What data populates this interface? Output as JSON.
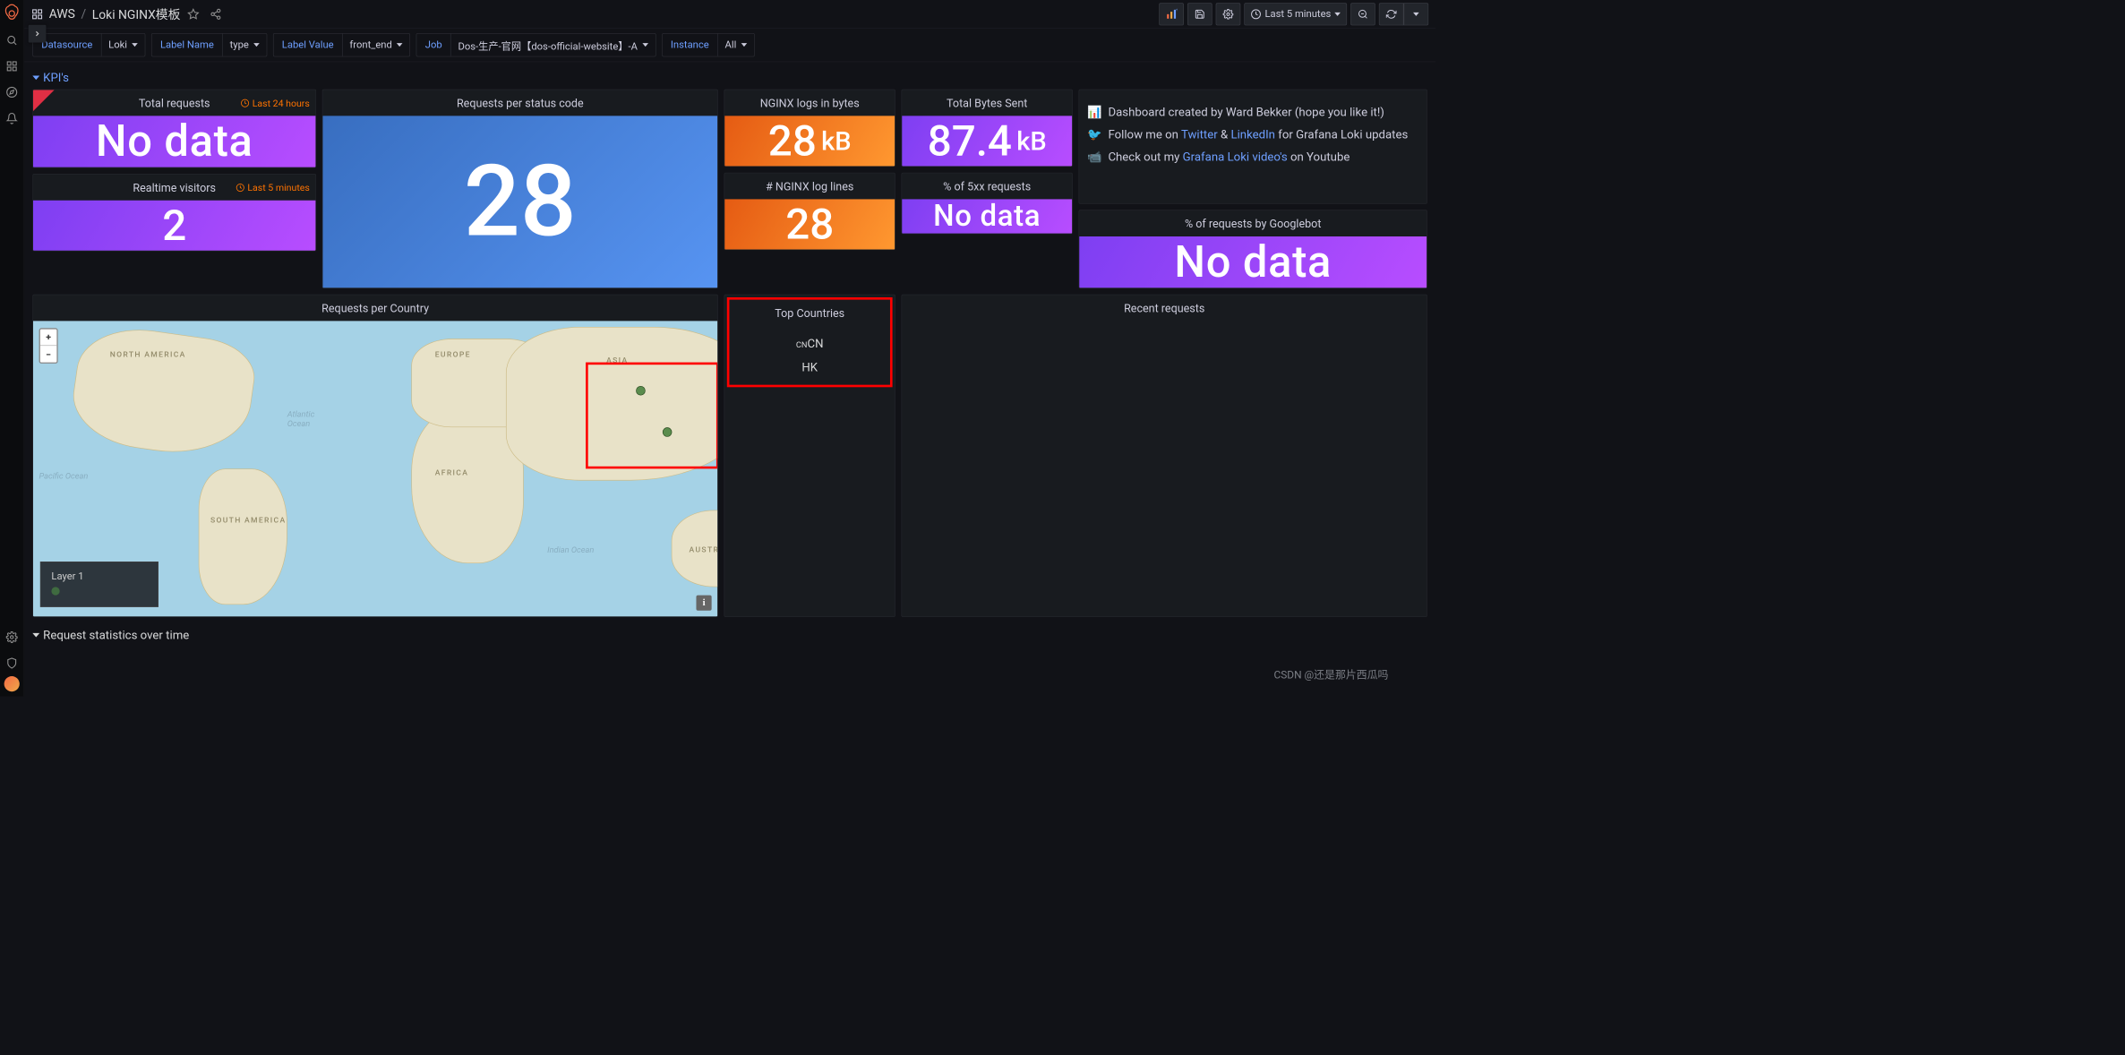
{
  "breadcrumb": {
    "root": "AWS",
    "page": "Loki NGINX模板"
  },
  "timepicker": {
    "label": "Last 5 minutes"
  },
  "variables": {
    "datasource": {
      "label": "Datasource",
      "value": "Loki"
    },
    "labelname": {
      "label": "Label Name",
      "value": "type"
    },
    "labelvalue": {
      "label": "Label Value",
      "value": "front_end"
    },
    "job": {
      "label": "Job",
      "value": "Dos-生产-官网【dos-official-website】-A"
    },
    "instance": {
      "label": "Instance",
      "value": "All"
    }
  },
  "rows": {
    "kpi": "KPI's",
    "stats": "Request statistics over time"
  },
  "panels": {
    "total_requests": {
      "title": "Total requests",
      "meta": "Last 24 hours",
      "value": "No data"
    },
    "realtime": {
      "title": "Realtime visitors",
      "meta": "Last 5 minutes",
      "value": "2"
    },
    "per_status": {
      "title": "Requests per status code",
      "value": "28"
    },
    "logs_bytes": {
      "title": "NGINX logs in bytes",
      "value": "28",
      "unit": "kB"
    },
    "total_bytes": {
      "title": "Total Bytes Sent",
      "value": "87.4",
      "unit": "kB"
    },
    "log_lines": {
      "title": "# NGINX log lines",
      "value": "28"
    },
    "pct_5xx": {
      "title": "% of 5xx requests",
      "value": "No data"
    },
    "pct_google": {
      "title": "% of requests by Googlebot",
      "value": "No data"
    },
    "per_country": {
      "title": "Requests per Country"
    },
    "top_countries": {
      "title": "Top Countries",
      "rows": [
        "CN",
        "HK"
      ],
      "row0_prefix": "CN"
    },
    "recent": {
      "title": "Recent requests"
    }
  },
  "textpanel": {
    "l1_a": "Dashboard created by Ward Bekker (hope you like it!)",
    "l2_a": "Follow me on ",
    "l2_b": "Twitter",
    "l2_c": " & ",
    "l2_d": "LinkedIn",
    "l2_e": " for Grafana Loki updates",
    "l3_a": "Check out my ",
    "l3_b": "Grafana Loki video's",
    "l3_c": " on Youtube"
  },
  "map": {
    "layer": "Layer 1",
    "labels": {
      "na": "NORTH AMERICA",
      "sa": "SOUTH AMERICA",
      "af": "AFRICA",
      "eu": "EUROPE",
      "as": "ASIA",
      "au": "AUSTRALIA",
      "pac": "Pacific Ocean",
      "atl": "Atlantic\nOcean",
      "ind": "Indian Ocean"
    }
  },
  "watermark": "CSDN @还是那片西瓜吗"
}
